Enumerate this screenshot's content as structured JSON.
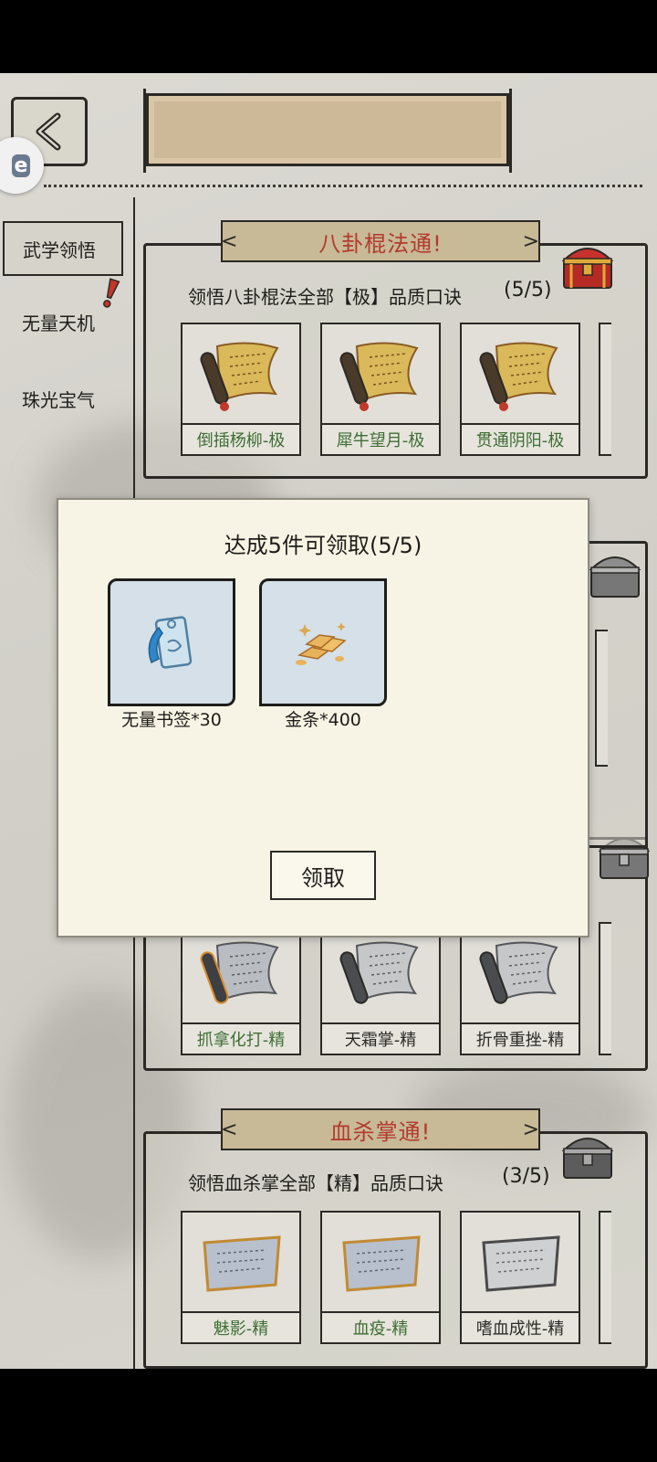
{
  "header": {
    "back_icon": "chevron-left-icon",
    "title": ""
  },
  "float_ball": {
    "label": "e"
  },
  "sidebar": {
    "items": [
      {
        "label": "武学领悟",
        "active": true,
        "alert": true
      },
      {
        "label": "无量天机",
        "active": false
      },
      {
        "label": "珠光宝气",
        "active": false
      }
    ]
  },
  "cards": [
    {
      "title": "八卦棍法通!",
      "description": "领悟八卦棍法全部【极】品质口诀",
      "progress": "(5/5)",
      "chest": "red-treasure-chest-icon",
      "items": [
        {
          "label": "倒插杨柳-极",
          "icon": "golden-scroll-icon"
        },
        {
          "label": "犀牛望月-极",
          "icon": "golden-scroll-icon"
        },
        {
          "label": "贯通阴阳-极",
          "icon": "golden-scroll-icon"
        }
      ]
    },
    {
      "title": "",
      "description": "",
      "progress": "",
      "chest": "grey-treasure-chest-icon",
      "items": [
        {
          "label": "抓拿化打-精",
          "icon": "grey-scroll-icon"
        },
        {
          "label": "天霜掌-精",
          "icon": "grey-scroll-icon"
        },
        {
          "label": "折骨重挫-精",
          "icon": "grey-scroll-icon"
        }
      ]
    },
    {
      "title": "血杀掌通!",
      "description": "领悟血杀掌全部【精】品质口诀",
      "progress": "(3/5)",
      "chest": "grey-treasure-chest-icon",
      "items": [
        {
          "label": "魅影-精",
          "icon": "silver-tablet-icon"
        },
        {
          "label": "血疫-精",
          "icon": "silver-tablet-icon"
        },
        {
          "label": "嗜血成性-精",
          "icon": "grey-tablet-icon"
        }
      ]
    }
  ],
  "modal": {
    "title": "达成5件可领取(5/5)",
    "rewards": [
      {
        "name": "无量书签*30",
        "icon": "jade-bookmark-icon"
      },
      {
        "name": "金条*400",
        "icon": "gold-bars-icon"
      }
    ],
    "claim_label": "领取"
  },
  "colors": {
    "title_red": "#b23b2e",
    "item_green": "#3f6e33",
    "modal_bg": "#f8f4e5"
  }
}
